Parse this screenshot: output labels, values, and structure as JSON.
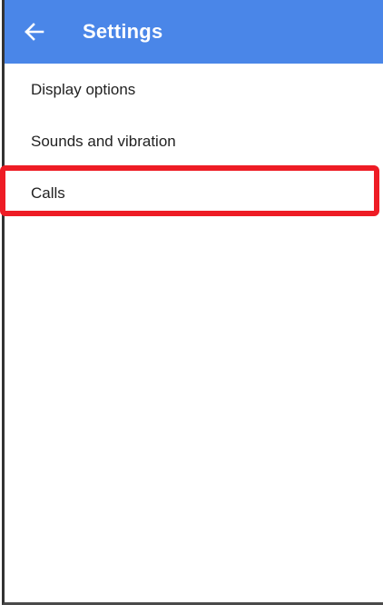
{
  "app_bar": {
    "back_icon": "back-arrow-icon",
    "title": "Settings",
    "color": "#4a86e8"
  },
  "settings_list": {
    "items": [
      {
        "label": "Display options"
      },
      {
        "label": "Sounds and vibration"
      },
      {
        "label": "Calls"
      }
    ]
  },
  "annotation": {
    "highlight_color": "#ee1c25",
    "highlighted_item": "Calls"
  }
}
